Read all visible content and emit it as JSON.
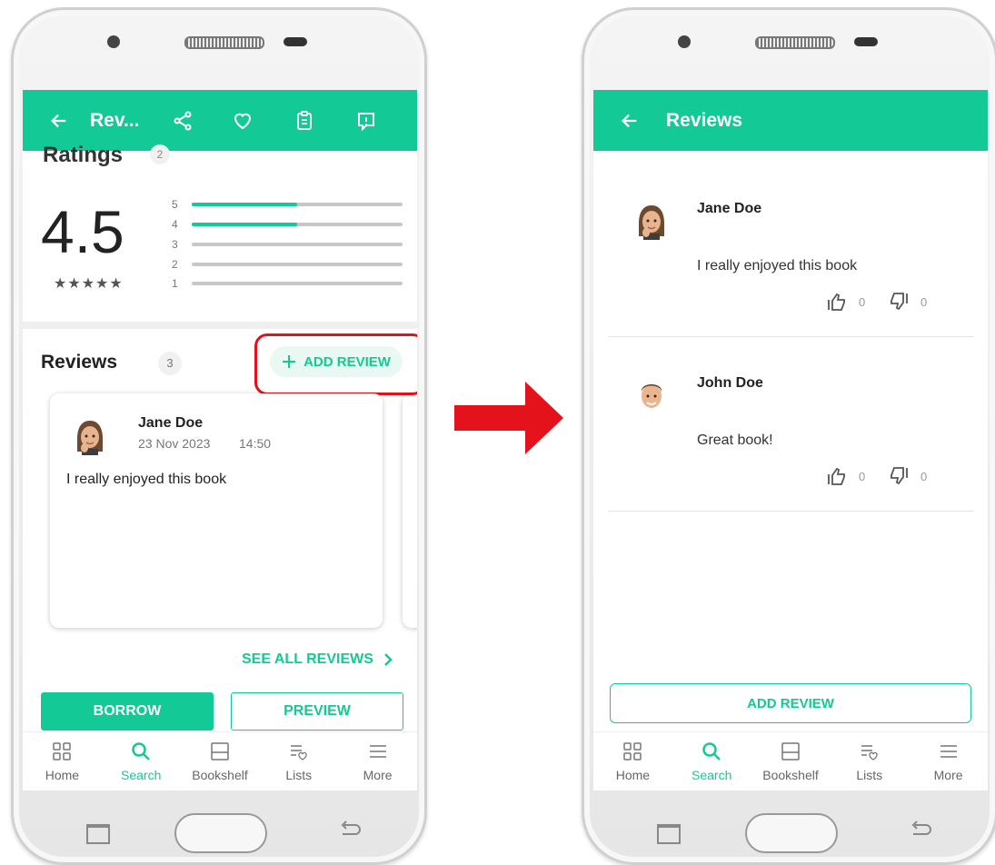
{
  "left": {
    "appbar": {
      "title": "Rev..."
    },
    "ratings": {
      "heading": "Ratings",
      "count": "2",
      "score": "4.5",
      "stars": "★★★★★",
      "bars": [
        {
          "label": "5",
          "fill": 0.5
        },
        {
          "label": "4",
          "fill": 0.5
        },
        {
          "label": "3",
          "fill": 0
        },
        {
          "label": "2",
          "fill": 0
        },
        {
          "label": "1",
          "fill": 0
        }
      ]
    },
    "reviews": {
      "heading": "Reviews",
      "count": "3",
      "add_label": "ADD REVIEW"
    },
    "card": {
      "name": "Jane Doe",
      "date": "23 Nov 2023",
      "time": "14:50",
      "text": "I really enjoyed this book"
    },
    "see_all": "SEE ALL REVIEWS",
    "borrow": "BORROW",
    "preview": "PREVIEW"
  },
  "right": {
    "appbar": {
      "title": "Reviews"
    },
    "reviews": [
      {
        "name": "Jane Doe",
        "text": "I really enjoyed this book",
        "likes": "0",
        "dislikes": "0"
      },
      {
        "name": "John Doe",
        "text": "Great book!",
        "likes": "0",
        "dislikes": "0"
      }
    ],
    "add_review": "ADD REVIEW"
  },
  "nav": [
    {
      "label": "Home",
      "icon": "grid-icon"
    },
    {
      "label": "Search",
      "icon": "search-icon"
    },
    {
      "label": "Bookshelf",
      "icon": "bookshelf-icon"
    },
    {
      "label": "Lists",
      "icon": "list-heart-icon"
    },
    {
      "label": "More",
      "icon": "menu-icon"
    }
  ],
  "colors": {
    "accent": "#13c995",
    "highlight": "#e4121b"
  }
}
